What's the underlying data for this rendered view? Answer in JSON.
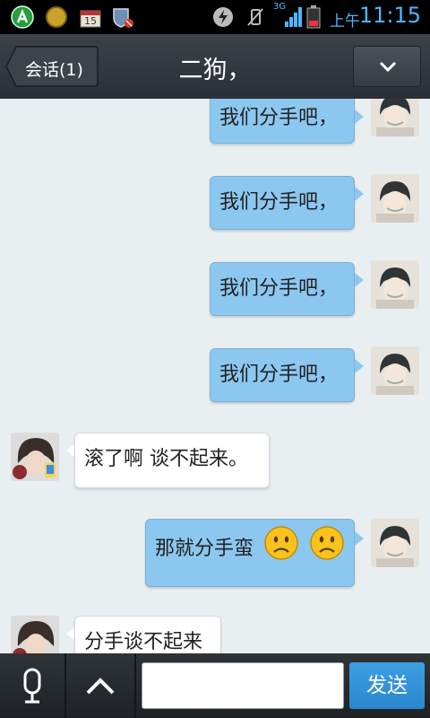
{
  "status_bar": {
    "time": "11:15",
    "ampm": "上午",
    "network": "3G",
    "calendar_day": "15",
    "icons": [
      "android-icon",
      "coin-icon",
      "calendar-icon",
      "shield-blocked-icon",
      "power-icon",
      "vibrate-off-icon",
      "signal-icon",
      "battery-icon"
    ]
  },
  "header": {
    "back_label": "会话(1)",
    "title": "二狗，",
    "menu_icon": "chevron-down-icon"
  },
  "messages": [
    {
      "from": "me",
      "text": "我们分手吧，"
    },
    {
      "from": "me",
      "text": "我们分手吧，"
    },
    {
      "from": "me",
      "text": "我们分手吧，"
    },
    {
      "from": "me",
      "text": "我们分手吧，"
    },
    {
      "from": "other",
      "text": "滚了啊 谈不起来。"
    },
    {
      "from": "me",
      "text": "那就分手蛮",
      "emojis": [
        "sad-face-icon",
        "sad-face-icon"
      ]
    },
    {
      "from": "other",
      "text": "分手谈不起来"
    }
  ],
  "bottom_bar": {
    "mic_icon": "microphone-icon",
    "expand_icon": "chevron-up-icon",
    "input_value": "",
    "send_label": "发送"
  },
  "colors": {
    "my_bubble": "#8cc7f0",
    "other_bubble": "#ffffff",
    "chat_background": "#e9eef1",
    "accent": "#4fb6ff",
    "send_button": "#2f8fd6"
  }
}
